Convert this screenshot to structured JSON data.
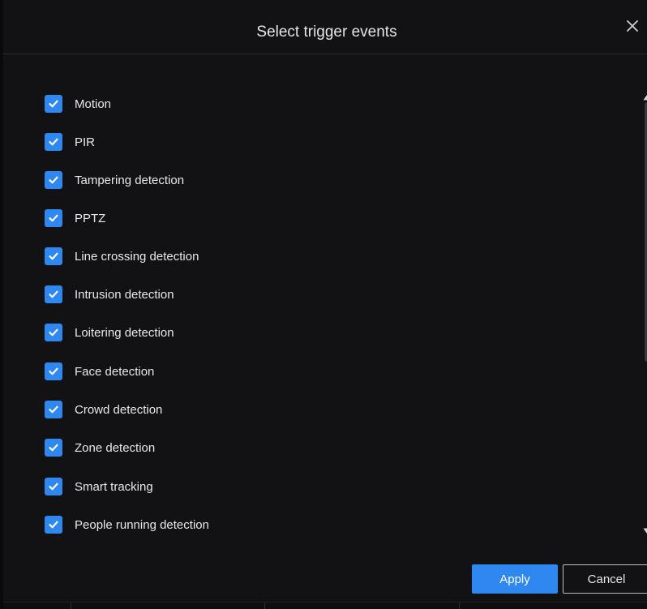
{
  "dialog": {
    "title": "Select trigger events",
    "close_icon": "close-icon"
  },
  "events": [
    {
      "label": "Motion",
      "checked": true
    },
    {
      "label": "PIR",
      "checked": true
    },
    {
      "label": "Tampering detection",
      "checked": true
    },
    {
      "label": "PPTZ",
      "checked": true
    },
    {
      "label": "Line crossing detection",
      "checked": true
    },
    {
      "label": "Intrusion detection",
      "checked": true
    },
    {
      "label": "Loitering detection",
      "checked": true
    },
    {
      "label": "Face detection",
      "checked": true
    },
    {
      "label": "Crowd detection",
      "checked": true
    },
    {
      "label": "Zone detection",
      "checked": true
    },
    {
      "label": "Smart tracking",
      "checked": true
    },
    {
      "label": "People running detection",
      "checked": true
    }
  ],
  "buttons": {
    "apply_label": "Apply",
    "cancel_label": "Cancel"
  },
  "colors": {
    "accent": "#2f88f0",
    "background": "#121214",
    "text": "#e8e8e8"
  }
}
